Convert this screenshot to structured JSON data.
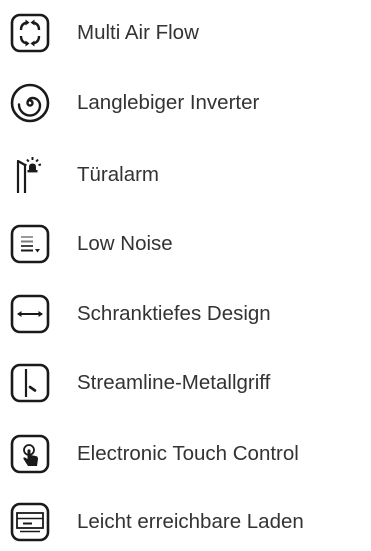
{
  "colors": {
    "text": "#333333",
    "icon_stroke": "#1a1a1a",
    "background": "#ffffff"
  },
  "features": [
    {
      "icon": "multi-air-flow-icon",
      "label": "Multi Air Flow"
    },
    {
      "icon": "inverter-spiral-icon",
      "label": "Langlebiger Inverter"
    },
    {
      "icon": "door-alarm-icon",
      "label": "Türalarm"
    },
    {
      "icon": "low-noise-icon",
      "label": "Low Noise"
    },
    {
      "icon": "cabinet-depth-icon",
      "label": "Schranktiefes Design"
    },
    {
      "icon": "metal-handle-icon",
      "label": "Streamline-Metallgriff"
    },
    {
      "icon": "touch-control-icon",
      "label": "Electronic Touch Control"
    },
    {
      "icon": "drawer-icon",
      "label": "Leicht erreichbare Laden"
    }
  ]
}
